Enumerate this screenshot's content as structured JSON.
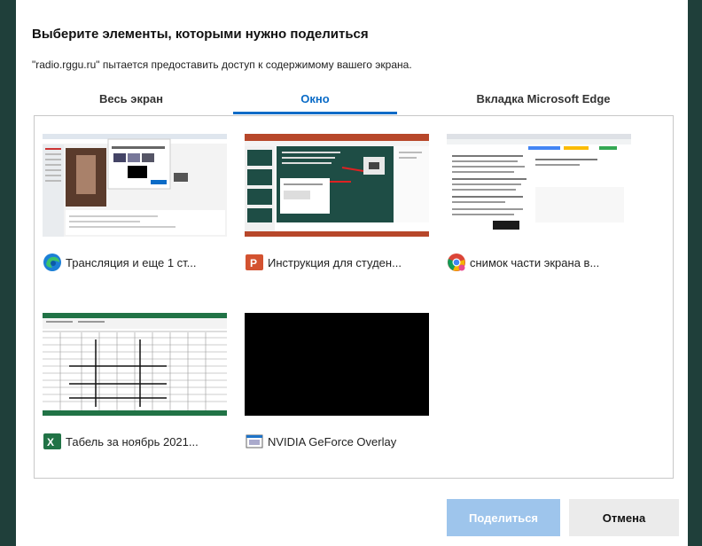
{
  "dialog": {
    "title": "Выберите элементы, которыми нужно поделиться",
    "subtitle": "\"radio.rggu.ru\" пытается предоставить доступ к содержимому вашего экрана."
  },
  "tabs": [
    {
      "label": "Весь экран",
      "active": false
    },
    {
      "label": "Окно",
      "active": true
    },
    {
      "label": "Вкладка Microsoft Edge",
      "active": false
    }
  ],
  "windows": [
    {
      "label": "Трансляция и еще 1 ст...",
      "icon": "edge-icon"
    },
    {
      "label": "Инструкция для студен...",
      "icon": "powerpoint-icon"
    },
    {
      "label": "снимок части экрана в...",
      "icon": "chrome-icon"
    },
    {
      "label": "Табель за ноябрь 2021...",
      "icon": "excel-icon"
    },
    {
      "label": "NVIDIA GeForce Overlay",
      "icon": "app-window-icon"
    }
  ],
  "buttons": {
    "share": "Поделиться",
    "cancel": "Отмена"
  },
  "colors": {
    "accent": "#0a6bc7",
    "share_disabled": "#9ec5ec",
    "background": "#1f3f3a"
  }
}
